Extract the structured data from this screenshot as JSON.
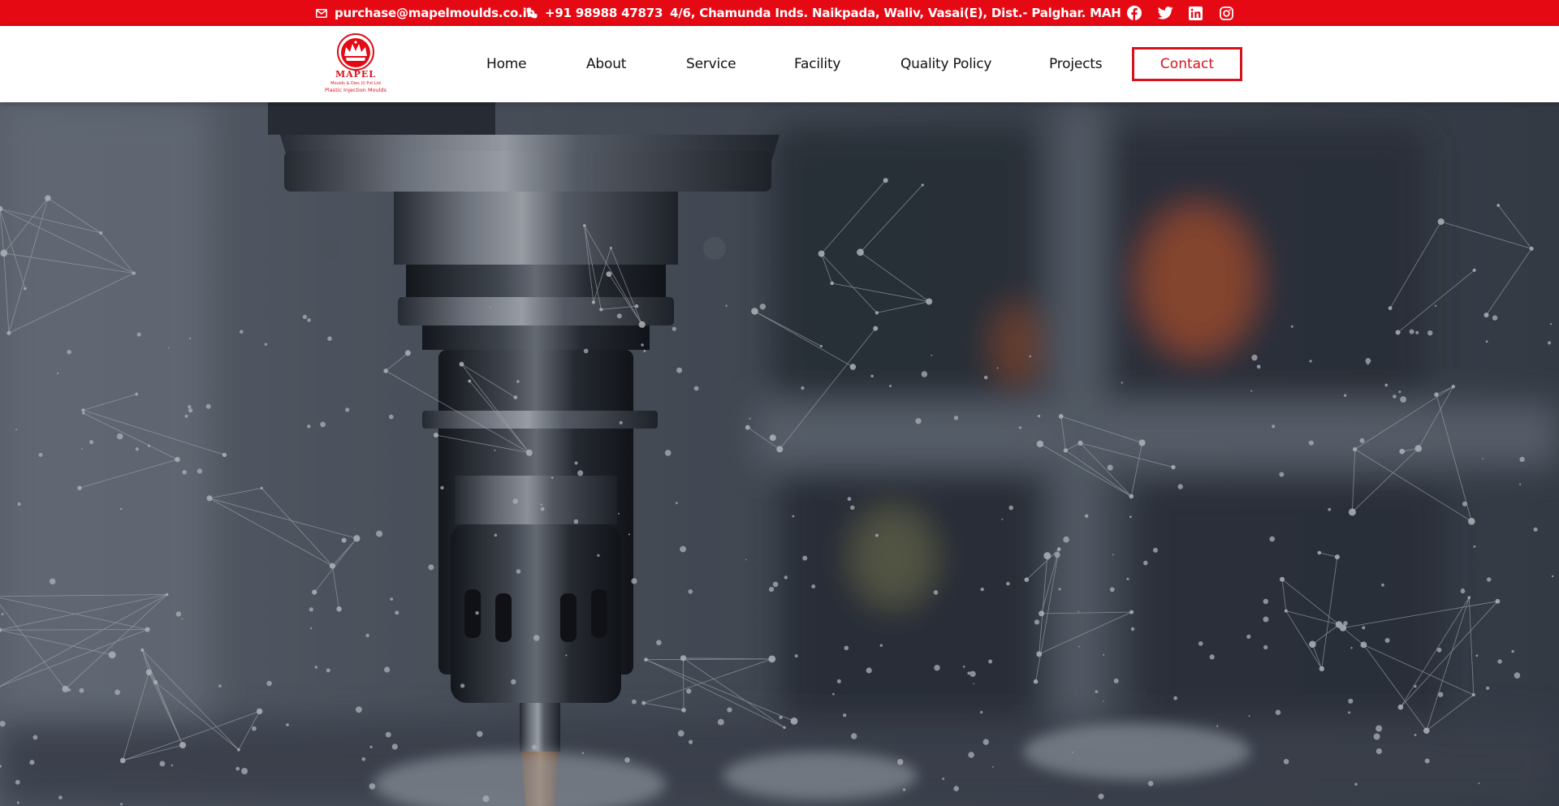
{
  "topbar": {
    "email": "purchase@mapelmoulds.co.in",
    "phone": "+91 98988 47873",
    "address": "4/6, Chamunda Inds. Naikpada, Waliv, Vasai(E), Dist.- Palghar. MAH",
    "social_icons": [
      "facebook-icon",
      "twitter-icon",
      "linkedin-icon",
      "instagram-icon"
    ]
  },
  "logo": {
    "name": "MAPEL",
    "tagline": "Moulds & Dies (I) Pvt Ltd",
    "subtitle": "Plastic Injection Moulds"
  },
  "nav": {
    "home": "Home",
    "about": "About",
    "service": "Service",
    "facility": "Facility",
    "quality": "Quality Policy",
    "projects": "Projects",
    "contact": "Contact"
  },
  "colors": {
    "brand_red": "#e50914",
    "header_bg": "#ffffff",
    "hero_overlay": "#3a404a"
  },
  "hero": {
    "image": "cnc-milling-spindle-photo",
    "overlay": "particle-network"
  }
}
